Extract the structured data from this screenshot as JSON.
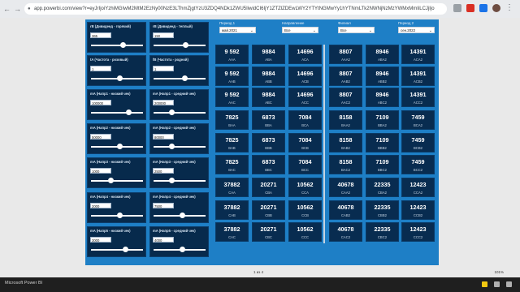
{
  "browser": {
    "url": "app.powerbi.com/view?r=eyJrIjoiYzhiMGIwM2MtM2EzNy00NzE3LThmZjgtYzU3ZDQ4NDk1ZWU5IiwidCI6IjY1ZTZlZDEwLWY2YTYtNGMwYy1hYTNmLTk2NWNjNzMzYWMxMmIiLCJjIjo",
    "icons": [
      "back-icon",
      "forward-icon",
      "reload-icon",
      "lock-icon",
      "star-icon",
      "extension-icon",
      "avatar-icon",
      "menu-icon"
    ]
  },
  "slicers": [
    {
      "title": "rB (Дивиденд - горячий)",
      "value": "365",
      "pos": 0.62
    },
    {
      "title": "rB (Дивиденд - теплый)",
      "value": "150",
      "pos": 0.62
    },
    {
      "title": "tA (Частота - розовый)",
      "value": "1",
      "pos": 0.55
    },
    {
      "title": "fB (Частота - родной)",
      "value": "1",
      "pos": 0.6
    },
    {
      "title": "mA (Напр1 - низкий чек)",
      "value": "100000",
      "pos": 0.72
    },
    {
      "title": "mA (Напр1 - средний чек)",
      "value": "200000",
      "pos": 0.35
    },
    {
      "title": "mA (Напр2 - низкий чек)",
      "value": "50000",
      "pos": 0.55
    },
    {
      "title": "mA (Напр2 - средний чек)",
      "value": "80000",
      "pos": 0.35
    },
    {
      "title": "mA (Напр3 - низкий чек)",
      "value": "1000",
      "pos": 0.38
    },
    {
      "title": "mA (Напр3 - средний чек)",
      "value": "2500",
      "pos": 0.35
    },
    {
      "title": "mA (Напр4 - низкий чек)",
      "value": "2000",
      "pos": 0.55
    },
    {
      "title": "mA (Напр4 - средний чек)",
      "value": "7500",
      "pos": 0.55
    },
    {
      "title": "mA (Напр5 - низкий чек)",
      "value": "3000",
      "pos": 0.66
    },
    {
      "title": "mA (Напр5 - средний чек)",
      "value": "4000",
      "pos": 0.55
    }
  ],
  "filters": [
    {
      "label": "Период 1",
      "value": "май.2021"
    },
    {
      "label": "Направление",
      "value": "Все"
    },
    {
      "label": "Филиал",
      "value": "Все"
    },
    {
      "label": "Период 2",
      "value": "сен.2022"
    }
  ],
  "cards_left": [
    [
      {
        "value": "9 592",
        "label": "AAA"
      },
      {
        "value": "9884",
        "label": "ABA"
      },
      {
        "value": "14696",
        "label": "ACA"
      }
    ],
    [
      {
        "value": "9 592",
        "label": "AAB"
      },
      {
        "value": "9884",
        "label": "ABB"
      },
      {
        "value": "14696",
        "label": "ACB"
      }
    ],
    [
      {
        "value": "9 592",
        "label": "AAC"
      },
      {
        "value": "9884",
        "label": "ABC"
      },
      {
        "value": "14696",
        "label": "ACC"
      }
    ],
    [
      {
        "value": "7825",
        "label": "BAA"
      },
      {
        "value": "6873",
        "label": "BBA"
      },
      {
        "value": "7084",
        "label": "BCA"
      }
    ],
    [
      {
        "value": "7825",
        "label": "BAB"
      },
      {
        "value": "6873",
        "label": "BBB"
      },
      {
        "value": "7084",
        "label": "BCB"
      }
    ],
    [
      {
        "value": "7825",
        "label": "BAC"
      },
      {
        "value": "6873",
        "label": "BBC"
      },
      {
        "value": "7084",
        "label": "BCC"
      }
    ],
    [
      {
        "value": "37882",
        "label": "CAA"
      },
      {
        "value": "20271",
        "label": "CBA"
      },
      {
        "value": "10562",
        "label": "CCA"
      }
    ],
    [
      {
        "value": "37882",
        "label": "CAB"
      },
      {
        "value": "20271",
        "label": "CBB"
      },
      {
        "value": "10562",
        "label": "CCB"
      }
    ],
    [
      {
        "value": "37882",
        "label": "CAC"
      },
      {
        "value": "20271",
        "label": "CBC"
      },
      {
        "value": "10562",
        "label": "CCC"
      }
    ]
  ],
  "cards_right": [
    [
      {
        "value": "8807",
        "label": "AAA2"
      },
      {
        "value": "8946",
        "label": "ABA2"
      },
      {
        "value": "14391",
        "label": "ACA2"
      }
    ],
    [
      {
        "value": "8807",
        "label": "AAB2"
      },
      {
        "value": "8946",
        "label": "ABB2"
      },
      {
        "value": "14391",
        "label": "ACB2"
      }
    ],
    [
      {
        "value": "8807",
        "label": "AAC2"
      },
      {
        "value": "8946",
        "label": "ABC2"
      },
      {
        "value": "14391",
        "label": "ACC2"
      }
    ],
    [
      {
        "value": "8158",
        "label": "BAA2"
      },
      {
        "value": "7109",
        "label": "BBA2"
      },
      {
        "value": "7459",
        "label": "BCA2"
      }
    ],
    [
      {
        "value": "8158",
        "label": "BAB2"
      },
      {
        "value": "7109",
        "label": "BBB2"
      },
      {
        "value": "7459",
        "label": "BCB2"
      }
    ],
    [
      {
        "value": "8158",
        "label": "BAC2"
      },
      {
        "value": "7109",
        "label": "BBC2"
      },
      {
        "value": "7459",
        "label": "BCC2"
      }
    ],
    [
      {
        "value": "40678",
        "label": "CAA2"
      },
      {
        "value": "22335",
        "label": "CBA2"
      },
      {
        "value": "12423",
        "label": "CCA2"
      }
    ],
    [
      {
        "value": "40678",
        "label": "CAB2"
      },
      {
        "value": "22335",
        "label": "CBB2"
      },
      {
        "value": "12423",
        "label": "CCB2"
      }
    ],
    [
      {
        "value": "40678",
        "label": "CAC2"
      },
      {
        "value": "22335",
        "label": "CBC2"
      },
      {
        "value": "12423",
        "label": "CCC2"
      }
    ]
  ],
  "status": {
    "pager": "1 из 4",
    "zoom": "101%"
  },
  "taskbar": {
    "title": "Microsoft Power BI"
  },
  "colors": {
    "report_bg": "#1e7fc6",
    "card_bg": "#082c50"
  }
}
